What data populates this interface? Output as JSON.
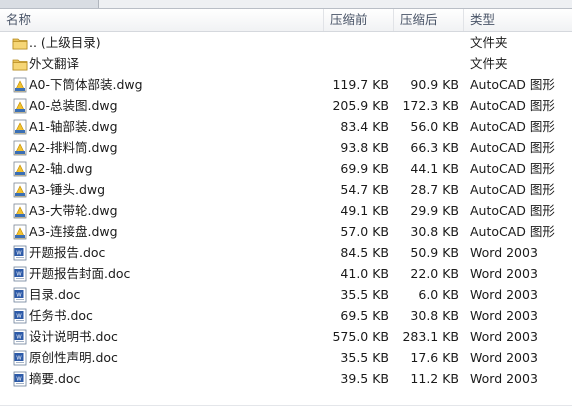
{
  "columns": {
    "name": "名称",
    "size": "压缩前",
    "compressed": "压缩后",
    "type": "类型"
  },
  "rows": [
    {
      "name": ".. (上级目录)",
      "size": "",
      "compressed": "",
      "type": "文件夹",
      "icon": "folder-icon"
    },
    {
      "name": "外文翻译",
      "size": "",
      "compressed": "",
      "type": "文件夹",
      "icon": "folder-icon"
    },
    {
      "name": "A0-下筒体部装.dwg",
      "size": "119.7 KB",
      "compressed": "90.9 KB",
      "type": "AutoCAD 图形",
      "icon": "dwg-file-icon"
    },
    {
      "name": "A0-总装图.dwg",
      "size": "205.9 KB",
      "compressed": "172.3 KB",
      "type": "AutoCAD 图形",
      "icon": "dwg-file-icon"
    },
    {
      "name": "A1-轴部装.dwg",
      "size": "83.4 KB",
      "compressed": "56.0 KB",
      "type": "AutoCAD 图形",
      "icon": "dwg-file-icon"
    },
    {
      "name": "A2-排料筒.dwg",
      "size": "93.8 KB",
      "compressed": "66.3 KB",
      "type": "AutoCAD 图形",
      "icon": "dwg-file-icon"
    },
    {
      "name": "A2-轴.dwg",
      "size": "69.9 KB",
      "compressed": "44.1 KB",
      "type": "AutoCAD 图形",
      "icon": "dwg-file-icon"
    },
    {
      "name": "A3-锤头.dwg",
      "size": "54.7 KB",
      "compressed": "28.7 KB",
      "type": "AutoCAD 图形",
      "icon": "dwg-file-icon"
    },
    {
      "name": "A3-大带轮.dwg",
      "size": "49.1 KB",
      "compressed": "29.9 KB",
      "type": "AutoCAD 图形",
      "icon": "dwg-file-icon"
    },
    {
      "name": "A3-连接盘.dwg",
      "size": "57.0 KB",
      "compressed": "30.8 KB",
      "type": "AutoCAD 图形",
      "icon": "dwg-file-icon"
    },
    {
      "name": "开题报告.doc",
      "size": "84.5 KB",
      "compressed": "50.9 KB",
      "type": "Word 2003",
      "icon": "doc-file-icon"
    },
    {
      "name": "开题报告封面.doc",
      "size": "41.0 KB",
      "compressed": "22.0 KB",
      "type": "Word 2003",
      "icon": "doc-file-icon"
    },
    {
      "name": "目录.doc",
      "size": "35.5 KB",
      "compressed": "6.0 KB",
      "type": "Word 2003",
      "icon": "doc-file-icon"
    },
    {
      "name": "任务书.doc",
      "size": "69.5 KB",
      "compressed": "30.8 KB",
      "type": "Word 2003",
      "icon": "doc-file-icon"
    },
    {
      "name": "设计说明书.doc",
      "size": "575.0 KB",
      "compressed": "283.1 KB",
      "type": "Word 2003",
      "icon": "doc-file-icon"
    },
    {
      "name": "原创性声明.doc",
      "size": "35.5 KB",
      "compressed": "17.6 KB",
      "type": "Word 2003",
      "icon": "doc-file-icon"
    },
    {
      "name": "摘要.doc",
      "size": "39.5 KB",
      "compressed": "11.2 KB",
      "type": "Word 2003",
      "icon": "doc-file-icon"
    }
  ]
}
